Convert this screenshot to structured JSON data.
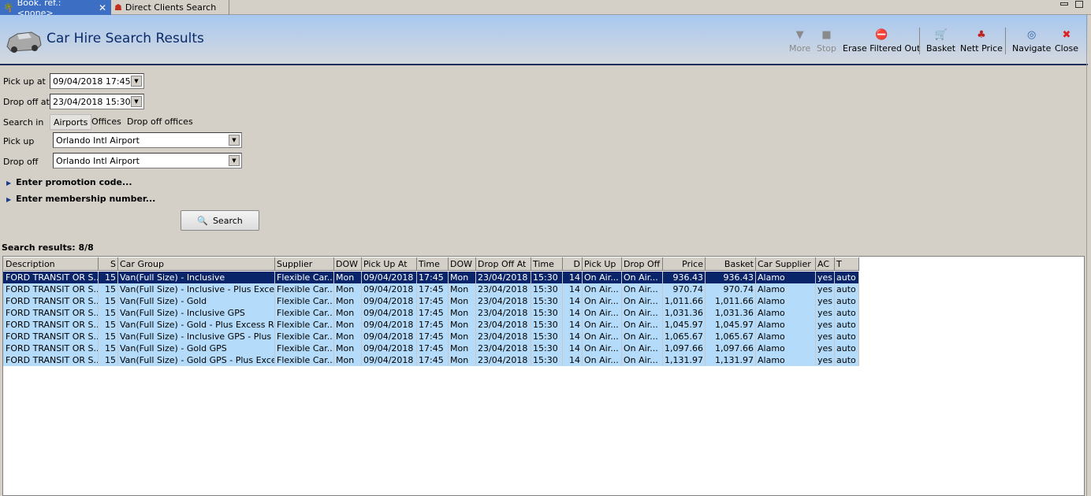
{
  "tabs": [
    {
      "label": "Book. ref.: <none>",
      "icon": "palm-tree-icon",
      "active": true
    },
    {
      "label": "Direct Clients Search",
      "icon": "person-icon",
      "active": false
    }
  ],
  "header": {
    "title": "Car Hire Search Results"
  },
  "toolbar": [
    {
      "label": "More",
      "icon": "triangle-down-icon",
      "disabled": true
    },
    {
      "label": "Stop",
      "icon": "stop-icon",
      "disabled": true
    },
    {
      "label": "Erase Filtered Out",
      "icon": "erase-icon",
      "disabled": false
    },
    {
      "label": "Basket",
      "icon": "basket-icon",
      "disabled": false
    },
    {
      "label": "Nett Price",
      "icon": "nett-price-icon",
      "disabled": false
    },
    {
      "label": "Navigate",
      "icon": "compass-icon",
      "disabled": false
    },
    {
      "label": "Close",
      "icon": "close-icon",
      "disabled": false
    }
  ],
  "form": {
    "pickup_at_label": "Pick up at",
    "pickup_at": "09/04/2018 17:45",
    "dropoff_at_label": "Drop off at",
    "dropoff_at": "23/04/2018 15:30",
    "search_in_label": "Search in",
    "search_in_options": [
      "Airports",
      "Offices",
      "Drop off offices"
    ],
    "pickup_label": "Pick up",
    "pickup": "Orlando Intl Airport",
    "dropoff_label": "Drop off",
    "dropoff": "Orlando Intl Airport",
    "promo": "Enter promotion code...",
    "membership": "Enter membership number...",
    "search_button": "Search"
  },
  "results": {
    "label": "Search results: 8/8",
    "columns": [
      "Description",
      "S",
      "Car Group",
      "Supplier",
      "DOW",
      "Pick Up At",
      "Time",
      "DOW",
      "Drop Off At",
      "Time",
      "D",
      "Pick Up",
      "Drop Off",
      "Price",
      "Basket",
      "Car Supplier",
      "AC",
      "T"
    ],
    "rows": [
      [
        "FORD TRANSIT OR S...",
        "15",
        "Van(Full Size) - Inclusive",
        "Flexible Car...",
        "Mon",
        "09/04/2018",
        "17:45",
        "Mon",
        "23/04/2018",
        "15:30",
        "14",
        "On Air...",
        "On Air...",
        "936.43",
        "936.43",
        "Alamo",
        "yes",
        "auto"
      ],
      [
        "FORD TRANSIT OR S...",
        "15",
        "Van(Full Size) - Inclusive - Plus Excess...",
        "Flexible Car...",
        "Mon",
        "09/04/2018",
        "17:45",
        "Mon",
        "23/04/2018",
        "15:30",
        "14",
        "On Air...",
        "On Air...",
        "970.74",
        "970.74",
        "Alamo",
        "yes",
        "auto"
      ],
      [
        "FORD TRANSIT OR S...",
        "15",
        "Van(Full Size) - Gold",
        "Flexible Car...",
        "Mon",
        "09/04/2018",
        "17:45",
        "Mon",
        "23/04/2018",
        "15:30",
        "14",
        "On Air...",
        "On Air...",
        "1,011.66",
        "1,011.66",
        "Alamo",
        "yes",
        "auto"
      ],
      [
        "FORD TRANSIT OR S...",
        "15",
        "Van(Full Size) - Inclusive GPS",
        "Flexible Car...",
        "Mon",
        "09/04/2018",
        "17:45",
        "Mon",
        "23/04/2018",
        "15:30",
        "14",
        "On Air...",
        "On Air...",
        "1,031.36",
        "1,031.36",
        "Alamo",
        "yes",
        "auto"
      ],
      [
        "FORD TRANSIT OR S...",
        "15",
        "Van(Full Size) - Gold - Plus Excess Ref...",
        "Flexible Car...",
        "Mon",
        "09/04/2018",
        "17:45",
        "Mon",
        "23/04/2018",
        "15:30",
        "14",
        "On Air...",
        "On Air...",
        "1,045.97",
        "1,045.97",
        "Alamo",
        "yes",
        "auto"
      ],
      [
        "FORD TRANSIT OR S...",
        "15",
        "Van(Full Size) - Inclusive GPS - Plus Ex...",
        "Flexible Car...",
        "Mon",
        "09/04/2018",
        "17:45",
        "Mon",
        "23/04/2018",
        "15:30",
        "14",
        "On Air...",
        "On Air...",
        "1,065.67",
        "1,065.67",
        "Alamo",
        "yes",
        "auto"
      ],
      [
        "FORD TRANSIT OR S...",
        "15",
        "Van(Full Size) - Gold GPS",
        "Flexible Car...",
        "Mon",
        "09/04/2018",
        "17:45",
        "Mon",
        "23/04/2018",
        "15:30",
        "14",
        "On Air...",
        "On Air...",
        "1,097.66",
        "1,097.66",
        "Alamo",
        "yes",
        "auto"
      ],
      [
        "FORD TRANSIT OR S...",
        "15",
        "Van(Full Size) - Gold GPS - Plus Excess...",
        "Flexible Car...",
        "Mon",
        "09/04/2018",
        "17:45",
        "Mon",
        "23/04/2018",
        "15:30",
        "14",
        "On Air...",
        "On Air...",
        "1,131.97",
        "1,131.97",
        "Alamo",
        "yes",
        "auto"
      ]
    ],
    "selected_row": 0
  }
}
